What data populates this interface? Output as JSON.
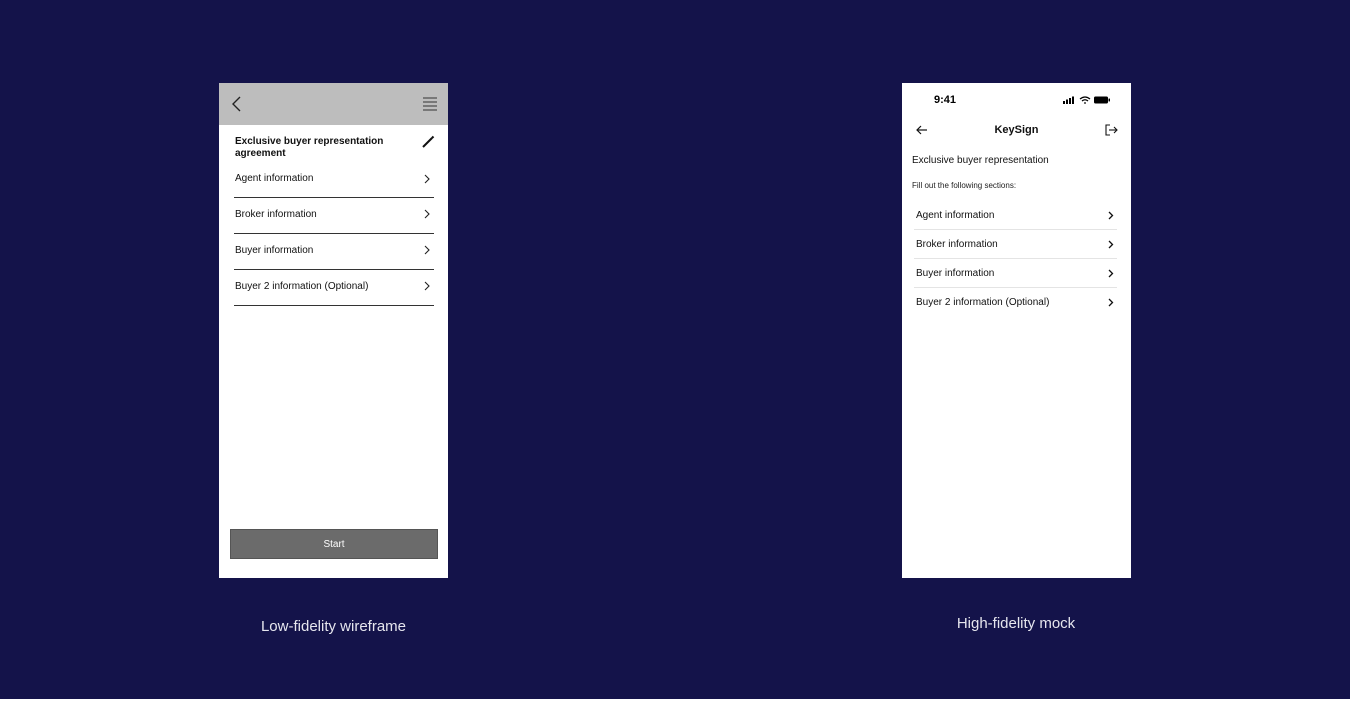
{
  "lofi": {
    "title": "Exclusive buyer representation agreement",
    "items": [
      {
        "label": "Agent information"
      },
      {
        "label": "Broker information"
      },
      {
        "label": "Buyer information"
      },
      {
        "label": "Buyer 2 information (Optional)"
      }
    ],
    "start_label": "Start",
    "caption": "Low-fidelity wireframe"
  },
  "hifi": {
    "status_time": "9:41",
    "app_title": "KeySign",
    "heading": "Exclusive buyer representation",
    "subheading": "Fill out the following sections:",
    "items": [
      {
        "label": "Agent information"
      },
      {
        "label": "Broker information"
      },
      {
        "label": "Buyer information"
      },
      {
        "label": "Buyer 2 information (Optional)"
      }
    ],
    "caption": "High-fidelity mock"
  },
  "colors": {
    "background": "#14134a",
    "lofi_bar": "#bdbdbd",
    "lofi_button": "#6b6b6b",
    "panel": "#ffffff"
  },
  "icons": [
    "back-chevron-icon",
    "hamburger-menu-icon",
    "pencil-icon",
    "chevron-right-icon",
    "signal-icon",
    "wifi-icon",
    "battery-icon",
    "arrow-left-icon",
    "logout-icon"
  ]
}
